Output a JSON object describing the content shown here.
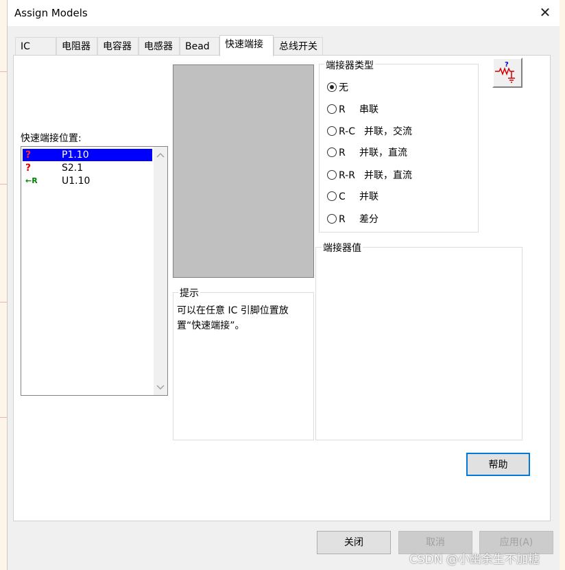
{
  "window": {
    "title": "Assign Models",
    "close_glyph": "✕"
  },
  "tabs": [
    {
      "label": "IC",
      "active": false
    },
    {
      "label": "电阻器",
      "active": false
    },
    {
      "label": "电容器",
      "active": false
    },
    {
      "label": "电感器",
      "active": false
    },
    {
      "label": "Bead",
      "active": false
    },
    {
      "label": "快速端接",
      "active": true
    },
    {
      "label": "总线开关",
      "active": false
    }
  ],
  "quick_term": {
    "list_label": "快速端接位置:",
    "items": [
      {
        "icon": "?",
        "icon_name": "question-icon",
        "name": "P1.10",
        "selected": true
      },
      {
        "icon": "?",
        "icon_name": "question-icon",
        "name": "S2.1",
        "selected": false
      },
      {
        "icon": "←R",
        "icon_name": "terminated-arrow-icon",
        "name": "U1.10",
        "selected": false
      }
    ]
  },
  "terminator_type": {
    "label": "端接器类型",
    "options": [
      {
        "code": "无",
        "desc": "",
        "checked": true
      },
      {
        "code": "R",
        "desc": "串联",
        "checked": false
      },
      {
        "code": "R-C",
        "desc": "并联，交流",
        "checked": false
      },
      {
        "code": "R",
        "desc": "并联，直流",
        "checked": false
      },
      {
        "code": "R-R",
        "desc": "并联，直流",
        "checked": false
      },
      {
        "code": "C",
        "desc": "并联",
        "checked": false
      },
      {
        "code": "R",
        "desc": "差分",
        "checked": false
      }
    ]
  },
  "hint": {
    "label": "提示",
    "text": "可以在任意 IC 引脚位置放置“快速端接”。"
  },
  "terminator_value": {
    "label": "端接器值"
  },
  "buttons": {
    "help": "帮助",
    "close": "关闭",
    "cancel": "取消",
    "apply": "应用(A)"
  },
  "watermark": "CSDN @小幽余生不加糖",
  "colors": {
    "selection": "#0000ff",
    "preview_bg": "#c0c0c0",
    "question_red": "#e00000",
    "arrow_green": "#008000"
  }
}
